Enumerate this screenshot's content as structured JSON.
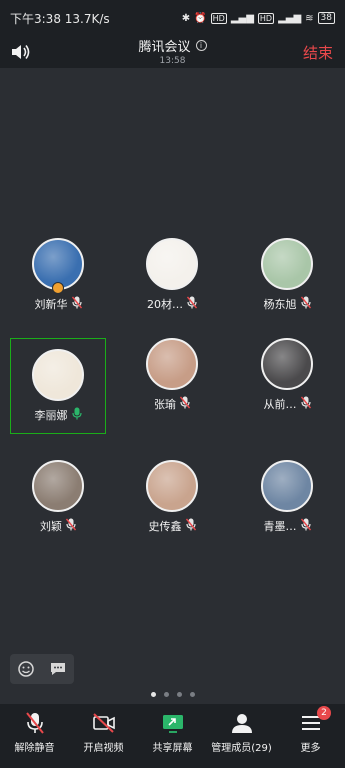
{
  "status_bar": {
    "time_speed": "下午3:38   13.7K/s",
    "tag_hd": "HD",
    "net_4g": "4G",
    "battery": "38"
  },
  "meeting": {
    "title": "腾讯会议",
    "timer": "13:58",
    "end_label": "结束"
  },
  "participants": [
    {
      "name": "刘新华",
      "avatar_color": "#3a6fb0",
      "host": true,
      "mic_on": false
    },
    {
      "name": "20材…",
      "avatar_color": "#f4f1ec",
      "host": false,
      "mic_on": false
    },
    {
      "name": "杨东旭",
      "avatar_color": "#a9c6a8",
      "host": false,
      "mic_on": false
    },
    {
      "name": "李丽娜",
      "avatar_color": "#efe7da",
      "host": false,
      "mic_on": true,
      "active": true
    },
    {
      "name": "张瑜",
      "avatar_color": "#c79d87",
      "host": false,
      "mic_on": false
    },
    {
      "name": "从前…",
      "avatar_color": "#4b4a4c",
      "host": false,
      "mic_on": false
    },
    {
      "name": "刘颖",
      "avatar_color": "#8b7d72",
      "host": false,
      "mic_on": false
    },
    {
      "name": "史传鑫",
      "avatar_color": "#c9a48e",
      "host": false,
      "mic_on": false
    },
    {
      "name": "青墨…",
      "avatar_color": "#6e86a3",
      "host": false,
      "mic_on": false
    }
  ],
  "toolbar": {
    "unmute_label": "解除静音",
    "video_label": "开启视频",
    "share_label": "共享屏幕",
    "members_label": "管理成员(29)",
    "more_label": "更多",
    "more_badge": "2"
  },
  "page_indicator": {
    "count": 4,
    "current": 1
  }
}
